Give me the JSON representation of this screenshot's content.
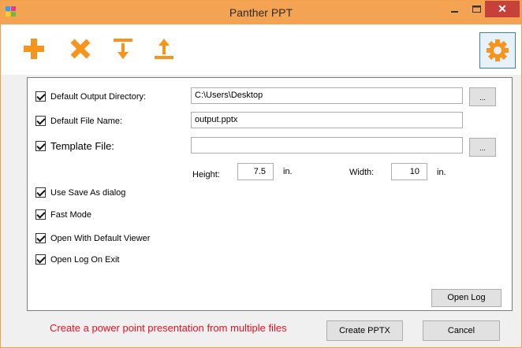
{
  "window": {
    "title": "Panther PPT",
    "minimize_glyph": "–",
    "maximize_glyph": "□",
    "close_glyph": "✕",
    "accent_color": "#f4a352",
    "icon_color": "#f7941d"
  },
  "toolbar": {
    "icons": [
      "add-icon",
      "remove-icon",
      "move-down-icon",
      "move-up-icon",
      "settings-gear-icon"
    ]
  },
  "settings": {
    "output_dir": {
      "label": "Default Output Directory:",
      "value": "C:\\Users\\Desktop",
      "browse": "..."
    },
    "file_name": {
      "label": "Default File Name:",
      "value": "output.pptx"
    },
    "template": {
      "label": "Template File:",
      "value": "",
      "browse": "..."
    },
    "height": {
      "label": "Height:",
      "value": "7.5",
      "unit": "in."
    },
    "width": {
      "label": "Width:",
      "value": "10",
      "unit": "in."
    },
    "options": [
      {
        "label": "Use Save As dialog",
        "checked": true
      },
      {
        "label": "Fast Mode",
        "checked": true
      },
      {
        "label": "Open With Default Viewer",
        "checked": true
      },
      {
        "label": "Open Log On Exit",
        "checked": true
      }
    ],
    "open_log": "Open Log"
  },
  "footer": {
    "status": "Create a power point presentation from multiple files",
    "create": "Create PPTX",
    "cancel": "Cancel",
    "status_color": "#e81123"
  }
}
